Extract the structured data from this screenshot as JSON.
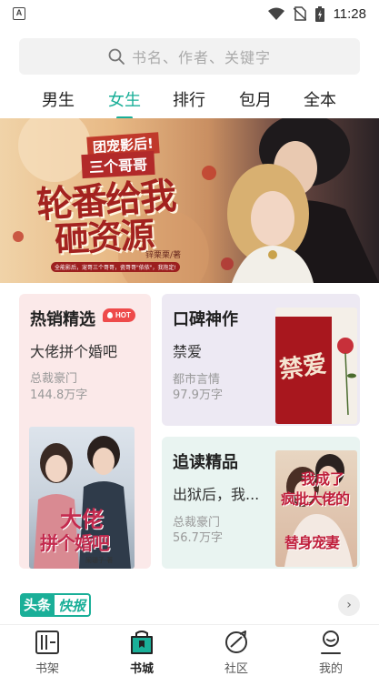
{
  "status_bar": {
    "time": "11:28",
    "left_icon": "A"
  },
  "search": {
    "placeholder": "书名、作者、关键字"
  },
  "tabs": [
    {
      "label": "男生",
      "active": false
    },
    {
      "label": "女生",
      "active": true
    },
    {
      "label": "排行",
      "active": false
    },
    {
      "label": "包月",
      "active": false
    },
    {
      "label": "全本",
      "active": false
    }
  ],
  "banner": {
    "line1": "团宠影后!",
    "line2": "三个哥哥",
    "line3": "轮番给我",
    "line4": "砸资源",
    "author": "锌栗栗/著",
    "tagline": "全能影后，宠哥三个哥哥，瓷哥哥\"依依\"，我抱定!"
  },
  "cards": {
    "hot": {
      "title": "热销精选",
      "badge": "HOT",
      "book": "大佬拼个婚吧",
      "tag": "总裁豪门",
      "count": "144.8万字",
      "cover_text_1": "大佬",
      "cover_text_2": "拼个婚吧",
      "cover_author": "阑珊子·著"
    },
    "praise": {
      "title": "口碑神作",
      "book": "禁爱",
      "tag": "都市言情",
      "count": "97.9万字",
      "cover_title": "禁爱"
    },
    "follow": {
      "title": "追读精品",
      "book": "出狱后，我...",
      "tag": "总裁豪门",
      "count": "56.7万字",
      "cover_text_1": "我成了",
      "cover_text_2": "疯批大佬的",
      "cover_text_3": "替身宠妻"
    }
  },
  "headline": {
    "part1": "头条",
    "part2": "快报"
  },
  "bottom_nav": [
    {
      "label": "书架",
      "icon": "bookshelf-icon",
      "active": false
    },
    {
      "label": "书城",
      "icon": "bookstore-icon",
      "active": true
    },
    {
      "label": "社区",
      "icon": "community-icon",
      "active": false
    },
    {
      "label": "我的",
      "icon": "profile-icon",
      "active": false
    }
  ],
  "colors": {
    "accent": "#1aaf98",
    "hot": "#ee4b4b"
  }
}
